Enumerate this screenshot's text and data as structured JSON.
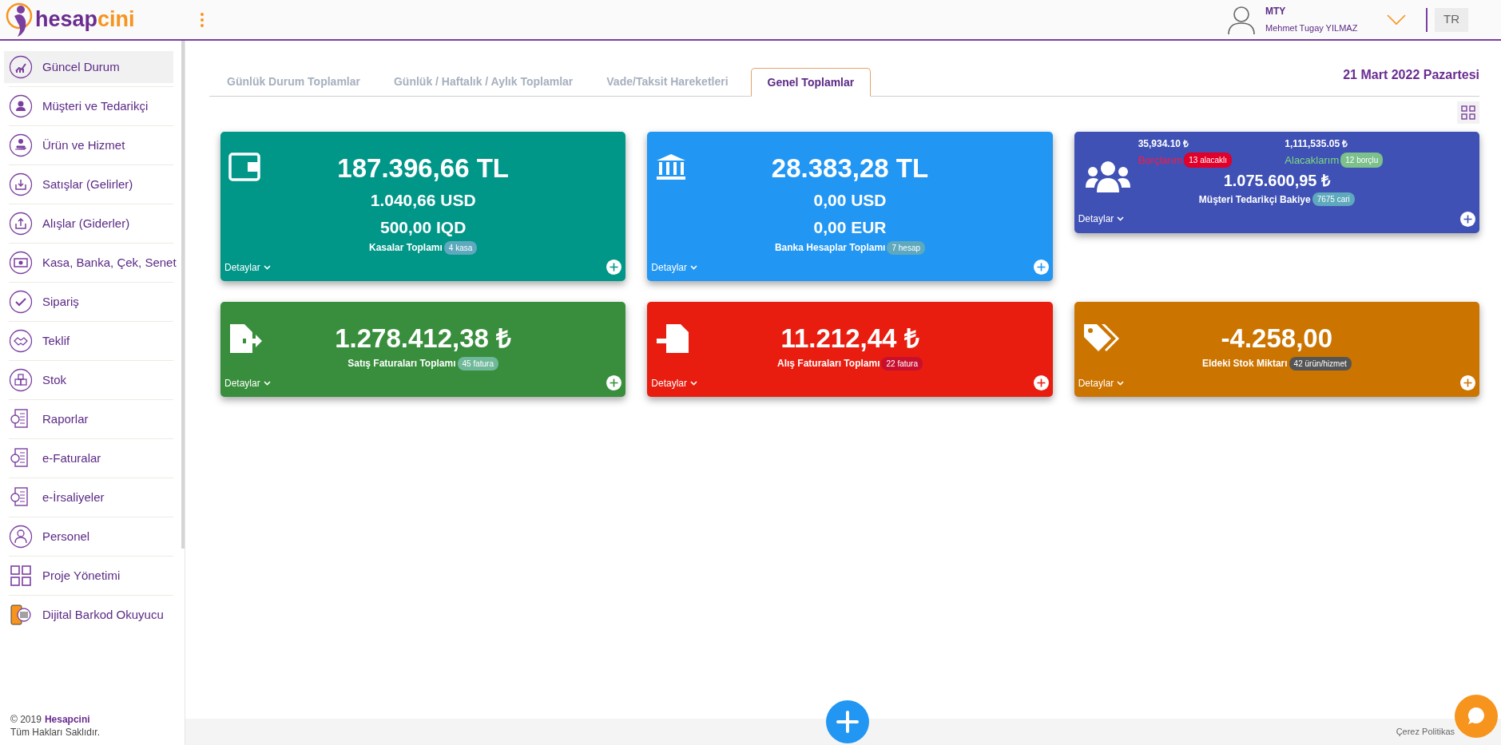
{
  "header": {
    "logo": {
      "part_1": "hesap",
      "part_2": "cini"
    },
    "user": {
      "initials": "MTY",
      "name": "Mehmet Tugay YILMAZ"
    },
    "language": "TR"
  },
  "sidebar": {
    "items": [
      {
        "label": "Güncel Durum",
        "selected": true
      },
      {
        "label": "Müşteri ve Tedarikçi",
        "selected": false
      },
      {
        "label": "Ürün ve Hizmet",
        "selected": false
      },
      {
        "label": "Satışlar (Gelirler)",
        "selected": false
      },
      {
        "label": "Alışlar (Giderler)",
        "selected": false
      },
      {
        "label": "Kasa, Banka, Çek, Senet",
        "selected": false
      },
      {
        "label": "Sipariş",
        "selected": false
      },
      {
        "label": "Teklif",
        "selected": false
      },
      {
        "label": "Stok",
        "selected": false
      },
      {
        "label": "Raporlar",
        "selected": false
      },
      {
        "label": "e-Faturalar",
        "selected": false
      },
      {
        "label": "e-İrsaliyeler",
        "selected": false
      },
      {
        "label": "Personel",
        "selected": false
      },
      {
        "label": "Proje Yönetimi",
        "selected": false
      },
      {
        "label": "Dijital Barkod Okuyucu",
        "selected": false
      }
    ],
    "footer": {
      "year": "© 2019",
      "brand": "Hesapcini",
      "rights": "Tüm Hakları Saklıdır."
    }
  },
  "tabs": [
    {
      "label": "Günlük Durum Toplamlar",
      "selected": false
    },
    {
      "label": "Günlük / Haftalık / Aylık Toplamlar",
      "selected": false
    },
    {
      "label": "Vade/Taksit Hareketleri",
      "selected": false
    },
    {
      "label": "Genel Toplamlar",
      "selected": true
    }
  ],
  "date": "21 Mart 2022 Pazartesi",
  "cards": [
    {
      "kind": "totals",
      "color": "#009688",
      "lines": [
        "187.396,66 TL",
        "1.040,66 USD",
        "500,00 IQD"
      ],
      "label": "Kasalar Toplamı",
      "badge": {
        "text": "4 kasa",
        "color": "#5ea9bd"
      },
      "details": "Detaylar"
    },
    {
      "kind": "totals",
      "color": "#2196f3",
      "lines": [
        "28.383,28 TL",
        "0,00 USD",
        "0,00 EUR"
      ],
      "label": "Banka Hesaplar Toplamı",
      "badge": {
        "text": "7 hesap",
        "color": "#5ea9bd"
      },
      "details": "Detaylar"
    },
    {
      "kind": "balance",
      "color": "#3f51b5",
      "debts": {
        "amount": "35,934.10 ₺",
        "label": "Borçlarım",
        "badge": {
          "text": "13 alacaklı",
          "color": "#e0002a"
        }
      },
      "receivables": {
        "amount": "1,111,535.05 ₺",
        "label": "Alacaklarım",
        "badge": {
          "text": "12 borçlu",
          "color": "#7cc08c"
        }
      },
      "lines": [
        "1.075.600,95 ₺"
      ],
      "label": "Müşteri Tedarikçi Bakiye",
      "badge": {
        "text": "7675 cari",
        "color": "#5ea9bd"
      },
      "details": "Detaylar"
    },
    {
      "kind": "totals",
      "color": "#388e3c",
      "lines": [
        "1.278.412,38 ₺"
      ],
      "label": "Satış Faturaları Toplamı",
      "badge": {
        "text": "45 fatura",
        "color": "#6fb89a"
      },
      "details": "Detaylar"
    },
    {
      "kind": "totals",
      "color": "#e91c10",
      "lines": [
        "11.212,44 ₺"
      ],
      "label": "Alış Faturaları Toplamı",
      "badge": {
        "text": "22 fatura",
        "color": "#c8102e"
      },
      "details": "Detaylar"
    },
    {
      "kind": "totals",
      "color": "#cc7400",
      "lines": [
        "-4.258,00"
      ],
      "label": "Eldeki Stok Miktarı",
      "badge": {
        "text": "42 ürün/hizmet",
        "color": "#555555"
      },
      "details": "Detaylar"
    }
  ],
  "footer": {
    "cookie_link": "Çerez Politikas"
  }
}
